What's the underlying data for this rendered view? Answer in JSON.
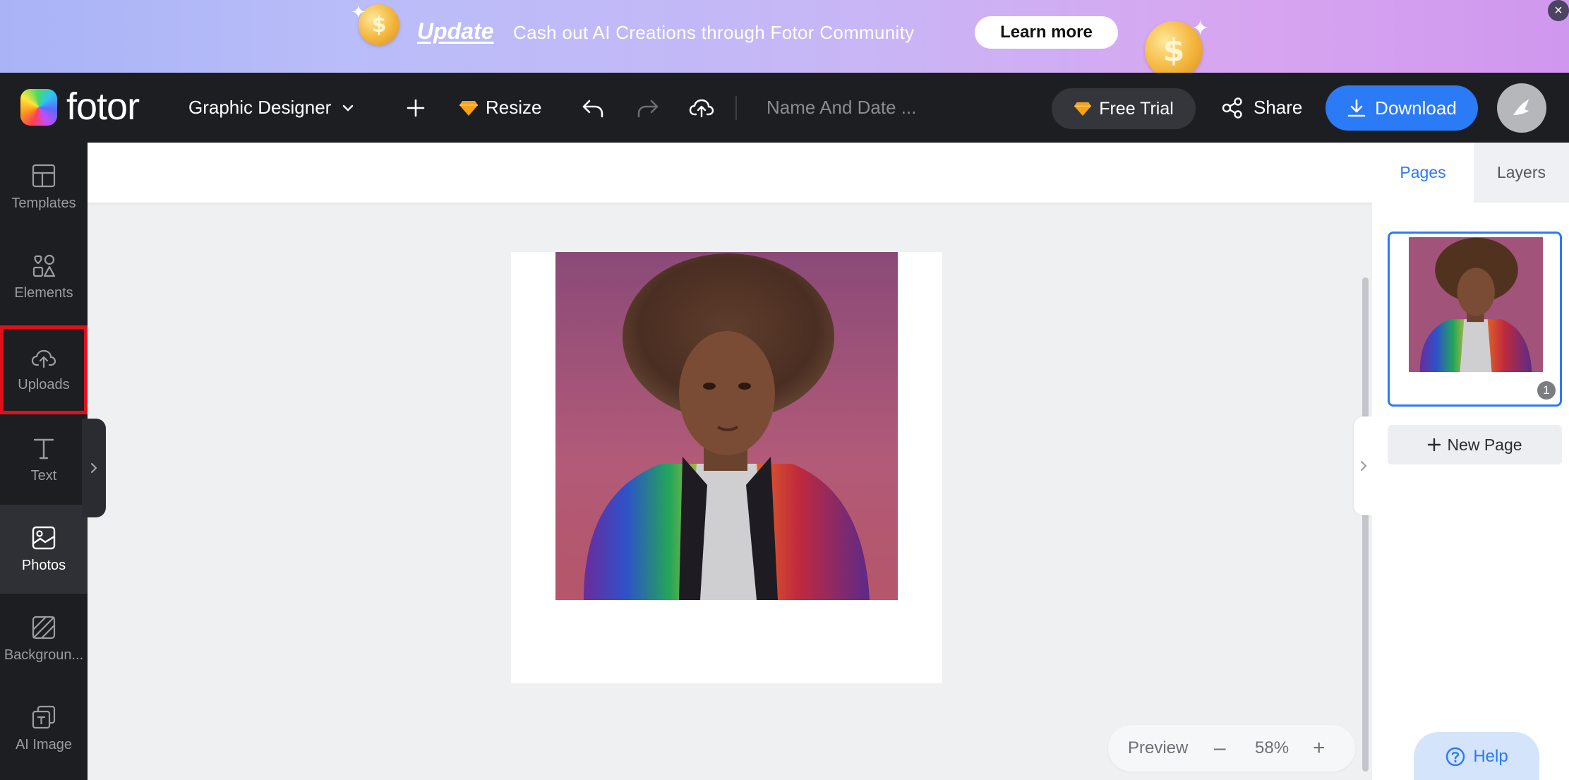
{
  "banner": {
    "tag": "Update",
    "text": "Cash out AI Creations through Fotor Community",
    "cta": "Learn more",
    "close": "×",
    "coin_symbol": "$"
  },
  "topbar": {
    "logo": "fotor",
    "project_type": "Graphic Designer",
    "resize": "Resize",
    "doc_name": "Name And Date ...",
    "free_trial": "Free Trial",
    "share": "Share",
    "download": "Download"
  },
  "sidebar": {
    "items": [
      {
        "label": "Templates",
        "icon": "templates-icon"
      },
      {
        "label": "Elements",
        "icon": "elements-icon"
      },
      {
        "label": "Uploads",
        "icon": "upload-cloud-icon"
      },
      {
        "label": "Text",
        "icon": "text-icon"
      },
      {
        "label": "Photos",
        "icon": "photos-icon"
      },
      {
        "label": "Backgroun...",
        "icon": "background-icon"
      },
      {
        "label": "AI Image",
        "icon": "ai-image-icon"
      }
    ],
    "active": "Photos",
    "highlighted": "Uploads"
  },
  "canvas": {
    "zoom": {
      "preview": "Preview",
      "value": "58%",
      "minus": "–",
      "plus": "+"
    }
  },
  "right_panel": {
    "tabs": [
      {
        "label": "Pages"
      },
      {
        "label": "Layers"
      }
    ],
    "active_tab": "Pages",
    "page_number": "1",
    "new_page": "New Page",
    "help": "Help"
  },
  "colors": {
    "accent": "#2b7af6",
    "topbar": "#1d1e22",
    "highlight": "#e0101b"
  }
}
